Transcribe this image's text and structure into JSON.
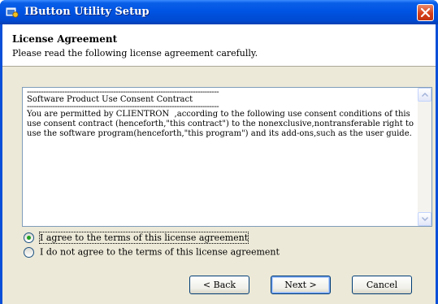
{
  "window": {
    "title": "IButton Utility Setup",
    "accent_color": "#0054e3",
    "close_icon": "close-icon"
  },
  "header": {
    "title": "License Agreement",
    "subtitle": "Please read the following license agreement carefully."
  },
  "license": {
    "separator": "----------------------------------------------------------------------------------",
    "heading": "Software Product Use Consent Contract",
    "paragraph_lines": [
      "You are permitted by CLIENTRON  ,according to the following use consent conditions of this",
      "use consent contract (henceforth,\"this contract\") to the nonexclusive,nontransferable right to",
      "use the software program(henceforth,\"this program\") and its add-ons,such as the user guide."
    ]
  },
  "options": {
    "agree": {
      "label": "I agree to the terms of this license agreement",
      "selected": true
    },
    "disagree": {
      "label": "I do not agree to the terms of this license agreement",
      "selected": false
    }
  },
  "buttons": {
    "back": "< Back",
    "next": "Next >",
    "cancel": "Cancel"
  }
}
